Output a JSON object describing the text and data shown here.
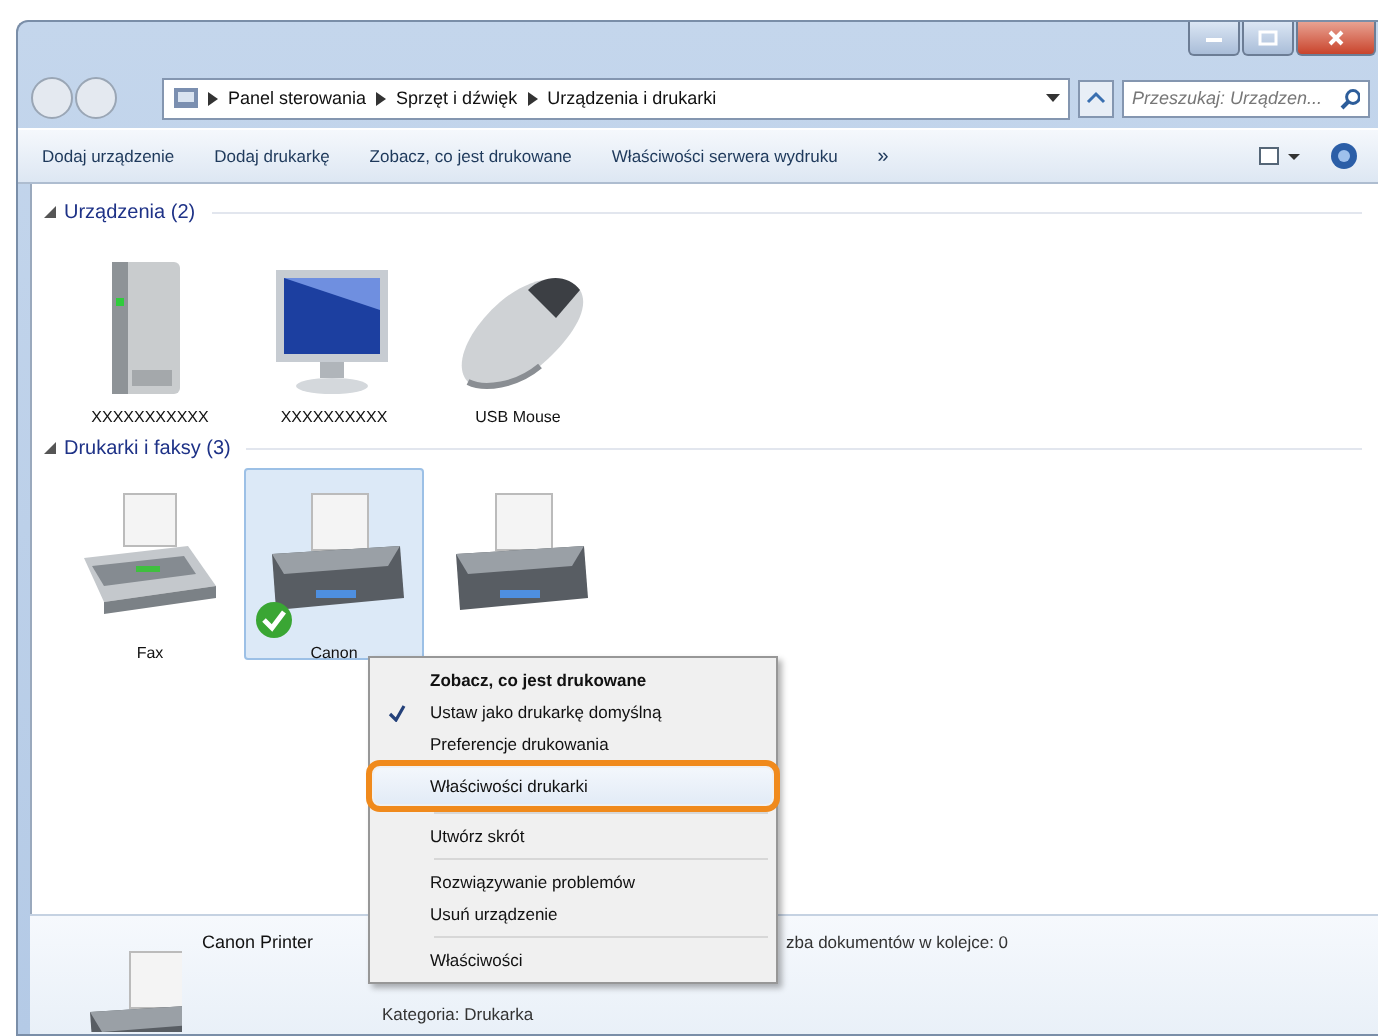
{
  "address_bar": {
    "path": [
      "Panel sterowania",
      "Sprzęt i dźwięk",
      "Urządzenia i drukarki"
    ],
    "search_placeholder": "Przeszukaj: Urządzen..."
  },
  "toolbar": {
    "buttons": [
      "Dodaj urządzenie",
      "Dodaj drukarkę",
      "Zobacz, co jest drukowane",
      "Właściwości serwera wydruku"
    ],
    "overflow": "»"
  },
  "sections": [
    {
      "title": "Urządzenia (2)",
      "items": [
        {
          "label": "XXXXXXXXXXX",
          "kind": "drive",
          "selected": false,
          "default": false
        },
        {
          "label": "XXXXXXXXXX",
          "kind": "monitor",
          "selected": false,
          "default": false
        },
        {
          "label": "USB Mouse",
          "kind": "mouse",
          "selected": false,
          "default": false
        }
      ]
    },
    {
      "title": "Drukarki i faksy (3)",
      "items": [
        {
          "label": "Fax",
          "kind": "fax",
          "selected": false,
          "default": false
        },
        {
          "label": "Canon",
          "kind": "printer",
          "selected": true,
          "default": true
        },
        {
          "kind": "printer",
          "selected": false,
          "default": false
        }
      ]
    }
  ],
  "context_menu": {
    "items": [
      {
        "kind": "item",
        "label": "Zobacz, co jest drukowane",
        "bold": true,
        "checked": false,
        "highlighted": false
      },
      {
        "kind": "item",
        "label": "Ustaw jako drukarkę domyślną",
        "bold": false,
        "checked": true,
        "highlighted": false
      },
      {
        "kind": "item",
        "label": "Preferencje drukowania",
        "bold": false,
        "checked": false,
        "highlighted": false
      },
      {
        "kind": "item",
        "label": "Właściwości drukarki",
        "bold": false,
        "checked": false,
        "highlighted": true
      },
      {
        "kind": "separator"
      },
      {
        "kind": "item",
        "label": "Utwórz skrót",
        "bold": false,
        "checked": false,
        "highlighted": false
      },
      {
        "kind": "separator"
      },
      {
        "kind": "item",
        "label": "Rozwiązywanie problemów",
        "bold": false,
        "checked": false,
        "highlighted": false
      },
      {
        "kind": "item",
        "label": "Usuń urządzenie",
        "bold": false,
        "checked": false,
        "highlighted": false
      },
      {
        "kind": "separator"
      },
      {
        "kind": "item",
        "label": "Właściwości",
        "bold": false,
        "checked": false,
        "highlighted": false
      }
    ]
  },
  "details": {
    "name": "Canon Printer",
    "status": "zba dokumentów w kolejce: 0",
    "category": "Kategoria: Drukarka"
  }
}
